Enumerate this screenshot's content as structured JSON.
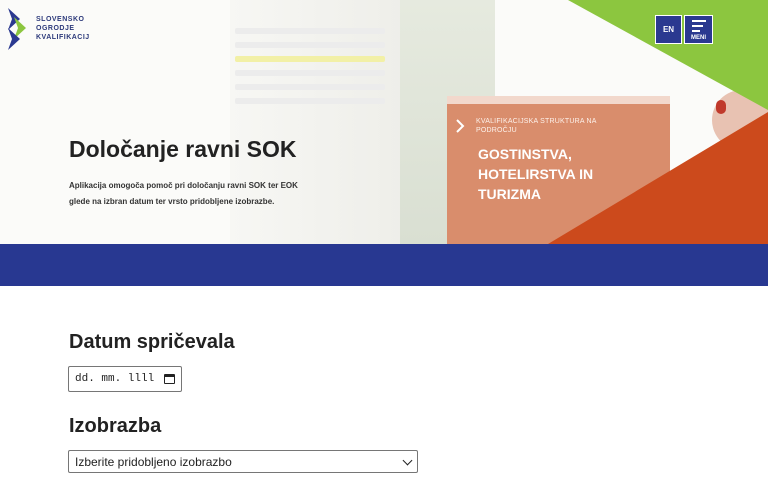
{
  "logo": {
    "lines": [
      "SLOVENSKO",
      "OGRODJE",
      "KVALIFIKACIJ"
    ]
  },
  "header": {
    "lang_label": "EN",
    "menu_label": "MENI"
  },
  "hero": {
    "title": "Določanje ravni SOK",
    "subtitle": "Aplikacija omogoča pomoč pri določanju ravni SOK ter EOK glede na izbran datum ter vrsto pridobljene izobrazbe.",
    "book_small": "KVALIFIKACIJSKA STRUKTURA NA PODROČJU",
    "book_big": "GOSTINSTVA, HOTELIRSTVA IN TURIZMA"
  },
  "form": {
    "date_heading": "Datum spričevala",
    "date_value": "dd. mm. llll",
    "education_heading": "Izobrazba",
    "education_selected": "Izberite pridobljeno izobrazbo"
  },
  "colors": {
    "brand_blue": "#283891",
    "green": "#8cc63f",
    "orange": "#cc4a1c"
  }
}
